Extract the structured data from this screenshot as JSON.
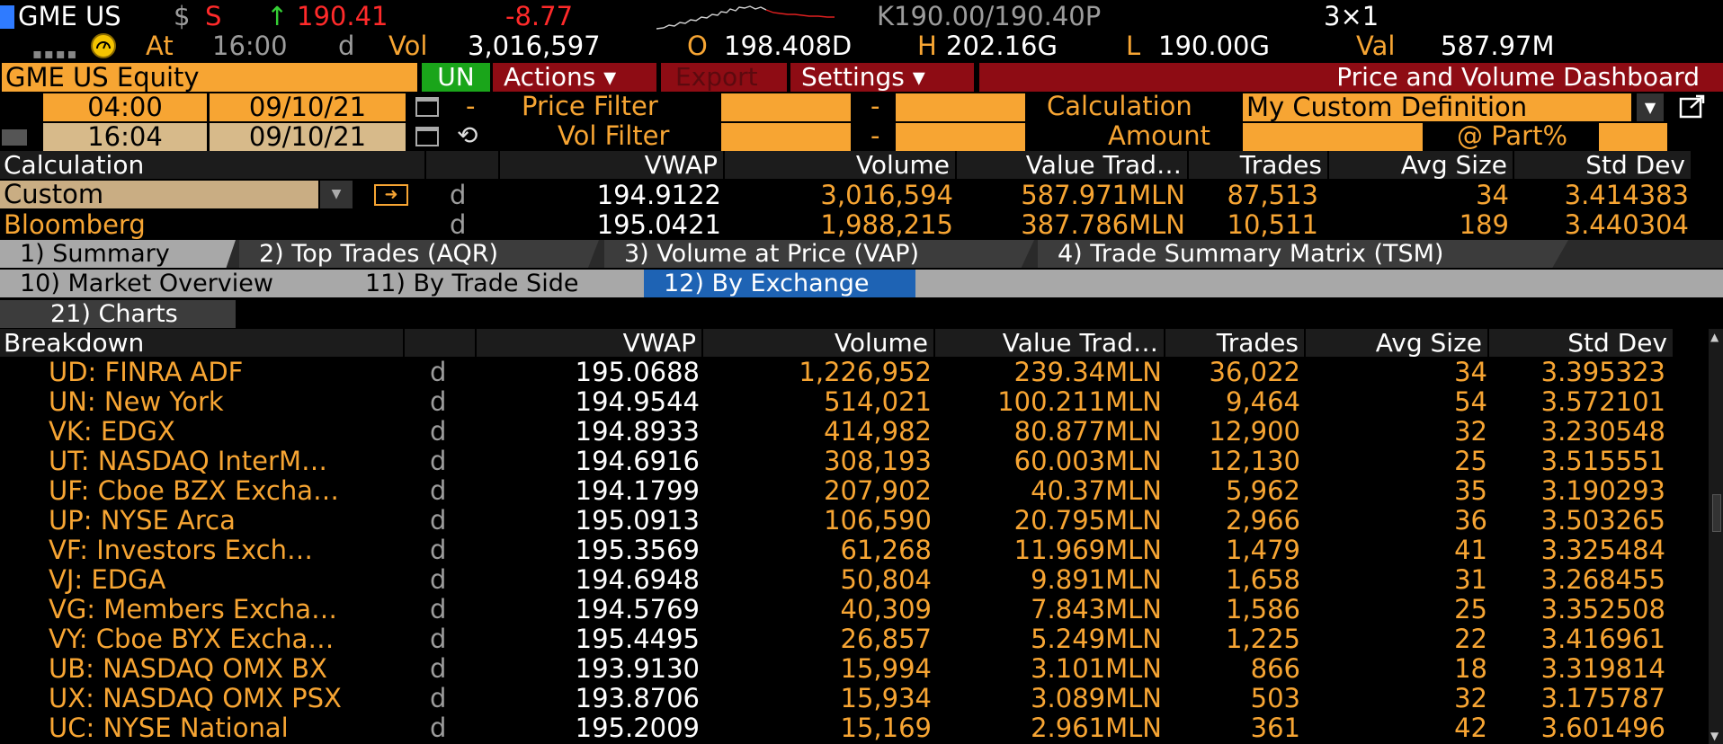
{
  "header": {
    "ticker": "GME US",
    "dollar": "$",
    "s_flag": "S",
    "arrow": "↑",
    "last": "190.41",
    "change": "-8.77",
    "bidask": "K190.00/190.40P",
    "size": "3×1",
    "at": "At",
    "time": "16:00",
    "time_suffix": "d",
    "vol_label": "Vol",
    "vol": "3,016,597",
    "open_label": "O",
    "open": "198.408D",
    "high_label": "H",
    "high": "202.16G",
    "low_label": "L",
    "low": "190.00G",
    "val_label": "Val",
    "val": "587.97M"
  },
  "toolbar": {
    "security": "GME US Equity",
    "exchange": "UN",
    "actions": "Actions ▾",
    "export": "Export",
    "settings": "Settings ▾",
    "title": "Price and Volume Dashboard"
  },
  "filters": {
    "start_time": "04:00",
    "start_date": "09/10/21",
    "end_time": "16:04",
    "end_date": "09/10/21",
    "dash": "-",
    "price_filter_label": "Price Filter",
    "vol_filter_label": "Vol Filter",
    "calculation_label": "Calculation",
    "calculation_value": "My Custom Definition",
    "amount_label": "Amount",
    "part_label": "@ Part%"
  },
  "calc_table": {
    "headers": [
      "Calculation",
      "VWAP",
      "Volume",
      "Value Trad…",
      "Trades",
      "Avg Size",
      "Std Dev"
    ],
    "rows": [
      {
        "name": "Custom",
        "d": "d",
        "vwap": "194.9122",
        "volume": "3,016,594",
        "value": "587.971MLN",
        "trades": "87,513",
        "avg": "34",
        "std": "3.414383"
      },
      {
        "name": "Bloomberg",
        "d": "d",
        "vwap": "195.0421",
        "volume": "1,988,215",
        "value": "387.786MLN",
        "trades": "10,511",
        "avg": "189",
        "std": "3.440304"
      }
    ]
  },
  "tabs": [
    {
      "label": "1) Summary"
    },
    {
      "label": "2) Top Trades (AQR)"
    },
    {
      "label": "3) Volume at Price (VAP)"
    },
    {
      "label": "4) Trade Summary Matrix (TSM)"
    }
  ],
  "subtabs": [
    {
      "label": "10) Market Overview"
    },
    {
      "label": "11) By Trade Side"
    },
    {
      "label": "12) By Exchange"
    }
  ],
  "charts_tab": "21) Charts",
  "breakdown": {
    "headers": [
      "Breakdown",
      "VWAP",
      "Volume",
      "Value Trad…",
      "Trades",
      "Avg Size",
      "Std Dev"
    ],
    "rows": [
      {
        "name": "UD: FINRA ADF",
        "d": "d",
        "vwap": "195.0688",
        "volume": "1,226,952",
        "value": "239.34MLN",
        "trades": "36,022",
        "avg": "34",
        "std": "3.395323"
      },
      {
        "name": "UN: New York",
        "d": "d",
        "vwap": "194.9544",
        "volume": "514,021",
        "value": "100.211MLN",
        "trades": "9,464",
        "avg": "54",
        "std": "3.572101"
      },
      {
        "name": "VK: EDGX",
        "d": "d",
        "vwap": "194.8933",
        "volume": "414,982",
        "value": "80.877MLN",
        "trades": "12,900",
        "avg": "32",
        "std": "3.230548"
      },
      {
        "name": "UT: NASDAQ InterM…",
        "d": "d",
        "vwap": "194.6916",
        "volume": "308,193",
        "value": "60.003MLN",
        "trades": "12,130",
        "avg": "25",
        "std": "3.515551"
      },
      {
        "name": "UF: Cboe BZX Excha…",
        "d": "d",
        "vwap": "194.1799",
        "volume": "207,902",
        "value": "40.37MLN",
        "trades": "5,962",
        "avg": "35",
        "std": "3.190293"
      },
      {
        "name": "UP: NYSE Arca",
        "d": "d",
        "vwap": "195.0913",
        "volume": "106,590",
        "value": "20.795MLN",
        "trades": "2,966",
        "avg": "36",
        "std": "3.503265"
      },
      {
        "name": "VF: Investors Exch…",
        "d": "d",
        "vwap": "195.3569",
        "volume": "61,268",
        "value": "11.969MLN",
        "trades": "1,479",
        "avg": "41",
        "std": "3.325484"
      },
      {
        "name": "VJ: EDGA",
        "d": "d",
        "vwap": "194.6948",
        "volume": "50,804",
        "value": "9.891MLN",
        "trades": "1,658",
        "avg": "31",
        "std": "3.268455"
      },
      {
        "name": "VG: Members Excha…",
        "d": "d",
        "vwap": "194.5769",
        "volume": "40,309",
        "value": "7.843MLN",
        "trades": "1,586",
        "avg": "25",
        "std": "3.352508"
      },
      {
        "name": "VY: Cboe BYX Excha…",
        "d": "d",
        "vwap": "195.4495",
        "volume": "26,857",
        "value": "5.249MLN",
        "trades": "1,225",
        "avg": "22",
        "std": "3.416961"
      },
      {
        "name": "UB: NASDAQ OMX BX",
        "d": "d",
        "vwap": "193.9130",
        "volume": "15,994",
        "value": "3.101MLN",
        "trades": "866",
        "avg": "18",
        "std": "3.319814"
      },
      {
        "name": "UX: NASDAQ OMX PSX",
        "d": "d",
        "vwap": "193.8706",
        "volume": "15,934",
        "value": "3.089MLN",
        "trades": "503",
        "avg": "32",
        "std": "3.175787"
      },
      {
        "name": "UC: NYSE National",
        "d": "d",
        "vwap": "195.2009",
        "volume": "15,169",
        "value": "2.961MLN",
        "trades": "361",
        "avg": "42",
        "std": "3.601496"
      }
    ]
  },
  "colors": {
    "accent": "#f7a533",
    "negative": "#ff2a2a",
    "bar": "#8e0c14",
    "selected": "#1e63b4"
  },
  "icons": [
    "calendar-icon",
    "refresh-icon",
    "export-arrow-icon",
    "dropdown-icon",
    "popout-icon",
    "scroll-up-icon",
    "scroll-down-icon"
  ]
}
